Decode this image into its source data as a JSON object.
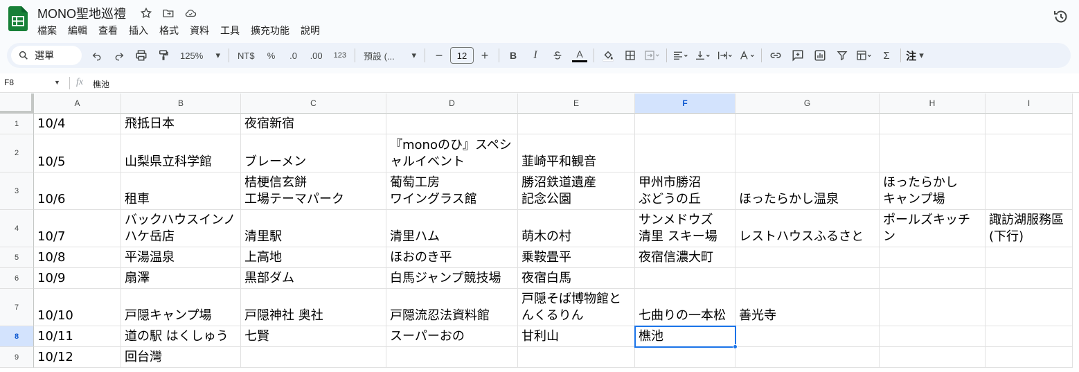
{
  "doc": {
    "title": "MONO聖地巡禮"
  },
  "menu": [
    "檔案",
    "編輯",
    "查看",
    "插入",
    "格式",
    "資料",
    "工具",
    "擴充功能",
    "說明"
  ],
  "toolbar": {
    "search_label": "選單",
    "zoom": "125%",
    "currency": "NT$",
    "percent": "%",
    "dec_less": ".0",
    "dec_more": ".00",
    "number_format": "123",
    "font": "預設 (...",
    "font_size": "12",
    "minus": "−",
    "plus": "+",
    "bold": "B",
    "italic": "I",
    "text_color_letter": "A",
    "sigma": "Σ",
    "notes": "注"
  },
  "formula_bar": {
    "cell_ref": "F8",
    "fx": "fx",
    "value": "樵池"
  },
  "colors": {
    "accent": "#1a73e8",
    "sheets_green": "#188038",
    "selected_header": "#d3e3fd"
  },
  "grid": {
    "columns": [
      "A",
      "B",
      "C",
      "D",
      "E",
      "F",
      "G",
      "H",
      "I"
    ],
    "selected_column": "F",
    "selected_row": "8",
    "rows": [
      {
        "num": "1",
        "cells": [
          "10/4",
          "飛抵日本",
          "夜宿新宿",
          "",
          "",
          "",
          "",
          "",
          ""
        ]
      },
      {
        "num": "2",
        "cells": [
          "10/5",
          "山梨県立科学館",
          "ブレーメン",
          "『monoのひ』スペシャルイベント",
          "韮崎平和観音",
          "",
          "",
          "",
          ""
        ]
      },
      {
        "num": "3",
        "cells": [
          "10/6",
          "租車",
          "桔梗信玄餅\n工場テーマパーク",
          "葡萄工房\nワイングラス館",
          "勝沼鉄道遺産\n記念公園",
          "甲州市勝沼\nぶどうの丘",
          "ほったらかし温泉",
          "ほったらかし\nキャンプ場",
          ""
        ]
      },
      {
        "num": "4",
        "cells": [
          "10/7",
          "バックハウスインノハケ岳店",
          "清里駅",
          "清里ハム",
          "萌木の村",
          "サンメドウズ\n清里 スキー場",
          "レストハウスふるさと",
          "ポールズキッチン",
          "諏訪湖服務區 (下行)"
        ]
      },
      {
        "num": "5",
        "cells": [
          "10/8",
          "平湯温泉",
          "上高地",
          "ほおのき平",
          "乗鞍畳平",
          "夜宿信濃大町",
          "",
          "",
          ""
        ]
      },
      {
        "num": "6",
        "cells": [
          "10/9",
          "扇澤",
          "黒部ダム",
          "白馬ジャンプ競技場",
          "夜宿白馬",
          "",
          "",
          "",
          ""
        ]
      },
      {
        "num": "7",
        "cells": [
          "10/10",
          "戸隠キャンプ場",
          "戸隠神社 奥社",
          "戸隠流忍法資料館",
          "戸隠そば博物館とんくるりん",
          "七曲りの一本松",
          "善光寺",
          "",
          ""
        ]
      },
      {
        "num": "8",
        "cells": [
          "10/11",
          "道の駅 はくしゅう",
          "七賢",
          "スーパーおの",
          "甘利山",
          "樵池",
          "",
          "",
          ""
        ]
      },
      {
        "num": "9",
        "cells": [
          "10/12",
          "回台灣",
          "",
          "",
          "",
          "",
          "",
          "",
          ""
        ]
      }
    ]
  }
}
